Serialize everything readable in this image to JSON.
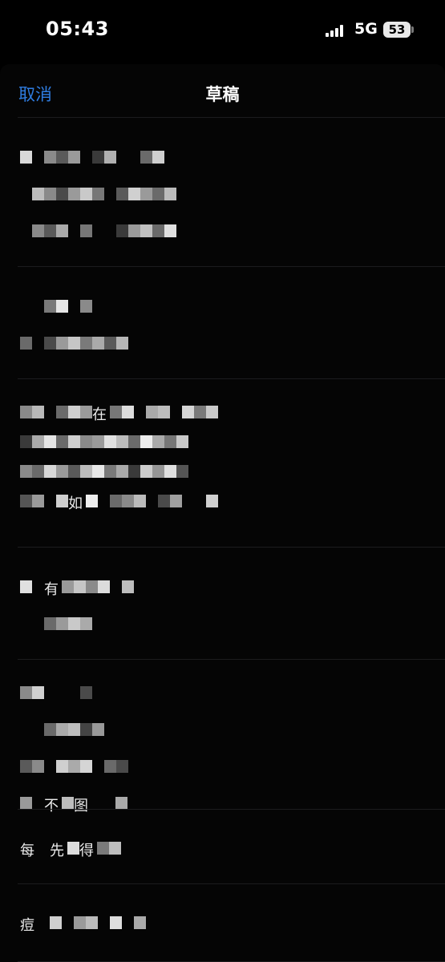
{
  "status_bar": {
    "time": "05:43",
    "network": "5G",
    "battery": "53"
  },
  "nav": {
    "cancel_label": "取消",
    "title": "草稿"
  },
  "drafts": [
    {
      "lines": [
        [
          {
            "c": "#d9d9d9"
          },
          {
            "g": 1
          },
          {
            "c": "#8a8a8a"
          },
          {
            "c": "#5a5a5a"
          },
          {
            "c": "#9a9a9a"
          },
          {
            "g": 1
          },
          {
            "c": "#3a3a3a"
          },
          {
            "c": "#b0b0b0"
          },
          {
            "g": 2
          },
          {
            "c": "#6a6a6a"
          },
          {
            "c": "#cfcfcf"
          }
        ],
        [
          {
            "g": 1
          },
          {
            "c": "#bdbdbd"
          },
          {
            "c": "#8a8a8a"
          },
          {
            "c": "#4a4a4a"
          },
          {
            "c": "#9a9a9a"
          },
          {
            "c": "#c9c9c9"
          },
          {
            "c": "#777"
          },
          {
            "g": 1
          },
          {
            "c": "#5a5a5a"
          },
          {
            "c": "#d0d0d0"
          },
          {
            "c": "#9a9a9a"
          },
          {
            "c": "#6a6a6a"
          },
          {
            "c": "#bbbbbb"
          }
        ],
        [
          {
            "g": 1
          },
          {
            "c": "#8a8a8a"
          },
          {
            "c": "#5a5a5a"
          },
          {
            "c": "#aaaaaa"
          },
          {
            "g": 1
          },
          {
            "c": "#777"
          },
          {
            "g": 2
          },
          {
            "c": "#3a3a3a"
          },
          {
            "c": "#9a9a9a"
          },
          {
            "c": "#c0c0c0"
          },
          {
            "c": "#6a6a6a"
          },
          {
            "c": "#e0e0e0"
          }
        ]
      ]
    },
    {
      "lines": [
        [
          {
            "g": 2
          },
          {
            "c": "#7a7a7a"
          },
          {
            "c": "#e6e6e6"
          },
          {
            "g": 1
          },
          {
            "c": "#8a8a8a"
          }
        ],
        [
          {
            "c": "#6a6a6a"
          },
          {
            "g": 1
          },
          {
            "c": "#4a4a4a"
          },
          {
            "c": "#9a9a9a"
          },
          {
            "c": "#c6c6c6"
          },
          {
            "c": "#7a7a7a"
          },
          {
            "c": "#aaaaaa"
          },
          {
            "c": "#5a5a5a"
          },
          {
            "c": "#b6b6b6"
          }
        ]
      ]
    },
    {
      "lines": [
        [
          {
            "c": "#8a8a8a"
          },
          {
            "c": "#b9b9b9"
          },
          {
            "g": 1
          },
          {
            "c": "#6a6a6a"
          },
          {
            "c": "#cfcfcf"
          },
          {
            "c": "#9a9a9a"
          },
          {
            "t": "在"
          },
          {
            "c": "#777"
          },
          {
            "c": "#ddd"
          },
          {
            "g": 1
          },
          {
            "c": "#aaaaaa"
          },
          {
            "c": "#bdbdbd"
          },
          {
            "g": 1
          },
          {
            "c": "#d5d5d5"
          },
          {
            "c": "#7a7a7a"
          },
          {
            "c": "#c9c9c9"
          }
        ],
        [
          {
            "c": "#3a3a3a"
          },
          {
            "c": "#aaaaaa"
          },
          {
            "c": "#e5e5e5"
          },
          {
            "c": "#6a6a6a"
          },
          {
            "c": "#cfcfcf"
          },
          {
            "c": "#8a8a8a"
          },
          {
            "c": "#9a9a9a"
          },
          {
            "c": "#e0e0e0"
          },
          {
            "c": "#bcbcbc"
          },
          {
            "c": "#6a6a6a"
          },
          {
            "c": "#ededed"
          },
          {
            "c": "#aaaaaa"
          },
          {
            "c": "#777"
          },
          {
            "c": "#c9c9c9"
          }
        ],
        [
          {
            "c": "#8a8a8a"
          },
          {
            "c": "#6a6a6a"
          },
          {
            "c": "#d7d7d7"
          },
          {
            "c": "#9a9a9a"
          },
          {
            "c": "#5a5a5a"
          },
          {
            "c": "#bbbbbb"
          },
          {
            "c": "#e8e8e8"
          },
          {
            "c": "#7a7a7a"
          },
          {
            "c": "#a9a9a9"
          },
          {
            "c": "#3a3a3a"
          },
          {
            "c": "#cccccc"
          },
          {
            "c": "#969696"
          },
          {
            "c": "#e0e0e0"
          },
          {
            "c": "#555"
          }
        ],
        [
          {
            "c": "#555"
          },
          {
            "c": "#9a9a9a"
          },
          {
            "g": 1
          },
          {
            "c": "#cfcfcf"
          },
          {
            "t": "如"
          },
          {
            "c": "#eeeeee"
          },
          {
            "g": 1
          },
          {
            "c": "#6a6a6a"
          },
          {
            "c": "#8a8a8a"
          },
          {
            "c": "#bbbbbb"
          },
          {
            "g": 1
          },
          {
            "c": "#4a4a4a"
          },
          {
            "c": "#a0a0a0"
          },
          {
            "g": 2
          },
          {
            "c": "#d0d0d0"
          }
        ]
      ]
    },
    {
      "lines": [
        [
          {
            "c": "#e0e0e0"
          },
          {
            "g": 1
          },
          {
            "t": "有"
          },
          {
            "c": "#9a9a9a"
          },
          {
            "c": "#c6c6c6"
          },
          {
            "c": "#8a8a8a"
          },
          {
            "c": "#dcdcdc"
          },
          {
            "g": 1
          },
          {
            "c": "#bdbdbd"
          }
        ],
        [
          {
            "g": 2
          },
          {
            "c": "#6a6a6a"
          },
          {
            "c": "#9a9a9a"
          },
          {
            "c": "#c9c9c9"
          },
          {
            "c": "#aaaaaa"
          }
        ]
      ]
    },
    {
      "lines": [
        [
          {
            "c": "#8a8a8a"
          },
          {
            "c": "#d0d0d0"
          },
          {
            "g": 3
          },
          {
            "c": "#4a4a4a"
          }
        ],
        [
          {
            "g": 2
          },
          {
            "c": "#6a6a6a"
          },
          {
            "c": "#aaaaaa"
          },
          {
            "c": "#bdbdbd"
          },
          {
            "c": "#444"
          },
          {
            "c": "#999"
          }
        ],
        [
          {
            "c": "#5a5a5a"
          },
          {
            "c": "#8a8a8a"
          },
          {
            "g": 1
          },
          {
            "c": "#cfcfcf"
          },
          {
            "c": "#aaaaaa"
          },
          {
            "c": "#d5d5d5"
          },
          {
            "g": 1
          },
          {
            "c": "#6a6a6a"
          },
          {
            "c": "#4a4a4a"
          }
        ],
        [
          {
            "c": "#9a9a9a"
          },
          {
            "g": 1
          },
          {
            "t": "不"
          },
          {
            "c": "#bdbdbd"
          },
          {
            "t": "图"
          },
          {
            "g": 2
          },
          {
            "c": "#aaaaaa"
          }
        ]
      ]
    },
    {
      "lines": [
        [
          {
            "t": "每"
          },
          {
            "g": 1
          },
          {
            "t": "先"
          },
          {
            "c": "#dddddd"
          },
          {
            "t": "得"
          },
          {
            "c": "#7a7a7a"
          },
          {
            "c": "#bdbdbd"
          }
        ]
      ]
    },
    {
      "lines": [
        [
          {
            "t": "痘"
          },
          {
            "g": 1
          },
          {
            "c": "#cfcfcf"
          },
          {
            "g": 1
          },
          {
            "c": "#9a9a9a"
          },
          {
            "c": "#bbbbbb"
          },
          {
            "g": 1
          },
          {
            "c": "#dddddd"
          },
          {
            "g": 1
          },
          {
            "c": "#aaaaaa"
          }
        ]
      ]
    }
  ]
}
